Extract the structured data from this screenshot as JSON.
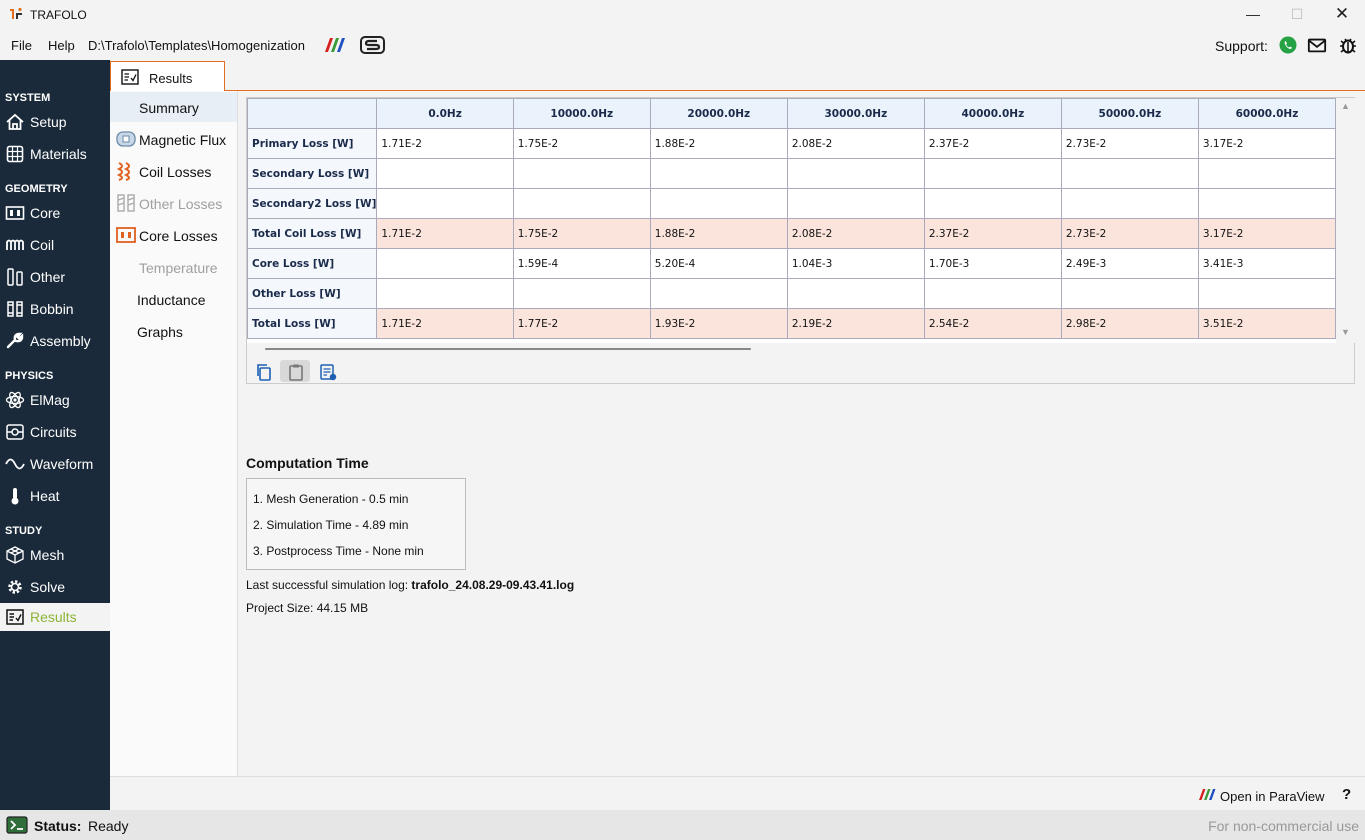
{
  "app": {
    "title": "TRAFOLO"
  },
  "window_controls": {
    "minimize": "—",
    "maximize": "☐",
    "close": "✕"
  },
  "menu": {
    "file": "File",
    "help": "Help",
    "path": "D:\\Trafolo\\Templates\\Homogenization",
    "support_label": "Support:"
  },
  "sidebar": {
    "sections": [
      {
        "title": "SYSTEM",
        "items": [
          {
            "label": "Setup",
            "icon": "house-icon"
          },
          {
            "label": "Materials",
            "icon": "materials-icon"
          }
        ]
      },
      {
        "title": "GEOMETRY",
        "items": [
          {
            "label": "Core",
            "icon": "core-icon"
          },
          {
            "label": "Coil",
            "icon": "coil-icon"
          },
          {
            "label": "Other",
            "icon": "other-icon"
          },
          {
            "label": "Bobbin",
            "icon": "bobbin-icon"
          },
          {
            "label": "Assembly",
            "icon": "wrench-icon"
          }
        ]
      },
      {
        "title": "PHYSICS",
        "items": [
          {
            "label": "ElMag",
            "icon": "atom-icon"
          },
          {
            "label": "Circuits",
            "icon": "circuit-icon"
          },
          {
            "label": "Waveform",
            "icon": "sine-wave-icon"
          },
          {
            "label": "Heat",
            "icon": "thermometer-icon"
          }
        ]
      },
      {
        "title": "STUDY",
        "items": [
          {
            "label": "Mesh",
            "icon": "mesh-icon"
          },
          {
            "label": "Solve",
            "icon": "gear-icon"
          },
          {
            "label": "Results",
            "icon": "results-icon",
            "active": true
          }
        ]
      }
    ]
  },
  "tab": {
    "label": "Results"
  },
  "subnav": {
    "items": [
      {
        "label": "Summary",
        "selected": true
      },
      {
        "label": "Magnetic Flux",
        "icon": "magnetic-flux-icon"
      },
      {
        "label": "Coil Losses",
        "icon": "coil-losses-icon"
      },
      {
        "label": "Other Losses",
        "icon": "other-losses-icon",
        "disabled": true
      },
      {
        "label": "Core Losses",
        "icon": "core-losses-icon"
      },
      {
        "label": "Temperature",
        "disabled": true
      },
      {
        "label": "Inductance"
      },
      {
        "label": "Graphs"
      }
    ]
  },
  "table": {
    "columns": [
      "0.0Hz",
      "10000.0Hz",
      "20000.0Hz",
      "30000.0Hz",
      "40000.0Hz",
      "50000.0Hz",
      "60000.0Hz"
    ],
    "rows": [
      {
        "label": "Primary Loss [W]",
        "values": [
          "1.71E-2",
          "1.75E-2",
          "1.88E-2",
          "2.08E-2",
          "2.37E-2",
          "2.73E-2",
          "3.17E-2"
        ],
        "highlight": false
      },
      {
        "label": "Secondary Loss [W]",
        "values": [
          "",
          "",
          "",
          "",
          "",
          "",
          ""
        ],
        "highlight": false
      },
      {
        "label": "Secondary2 Loss [W]",
        "values": [
          "",
          "",
          "",
          "",
          "",
          "",
          ""
        ],
        "highlight": false
      },
      {
        "label": "Total Coil Loss [W]",
        "values": [
          "1.71E-2",
          "1.75E-2",
          "1.88E-2",
          "2.08E-2",
          "2.37E-2",
          "2.73E-2",
          "3.17E-2"
        ],
        "highlight": true
      },
      {
        "label": "Core Loss [W]",
        "values": [
          "",
          "1.59E-4",
          "5.20E-4",
          "1.04E-3",
          "1.70E-3",
          "2.49E-3",
          "3.41E-3"
        ],
        "highlight": false
      },
      {
        "label": "Other Loss [W]",
        "values": [
          "",
          "",
          "",
          "",
          "",
          "",
          ""
        ],
        "highlight": false
      },
      {
        "label": "Total Loss [W]",
        "values": [
          "1.71E-2",
          "1.77E-2",
          "1.93E-2",
          "2.19E-2",
          "2.54E-2",
          "2.98E-2",
          "3.51E-2"
        ],
        "highlight": true
      }
    ]
  },
  "computation": {
    "title": "Computation Time",
    "lines": [
      "1. Mesh Generation -  0.5 min",
      "2. Simulation Time -  4.89 min",
      "3. Postprocess Time -  None min"
    ],
    "log_label": "Last successful simulation log:",
    "log_file": "trafolo_24.08.29-09.43.41.log",
    "size_label": "Project Size:",
    "size_value": "44.15 MB"
  },
  "footer": {
    "paraview_label": "Open in ParaView",
    "help_label": "?"
  },
  "status": {
    "label": "Status:",
    "value": "Ready",
    "license": "For non-commercial use"
  },
  "colors": {
    "sidebar_bg": "#1a2a3a",
    "accent": "#e07020",
    "active_text": "#8cb43a",
    "highlight_row": "#fbe4dc"
  }
}
